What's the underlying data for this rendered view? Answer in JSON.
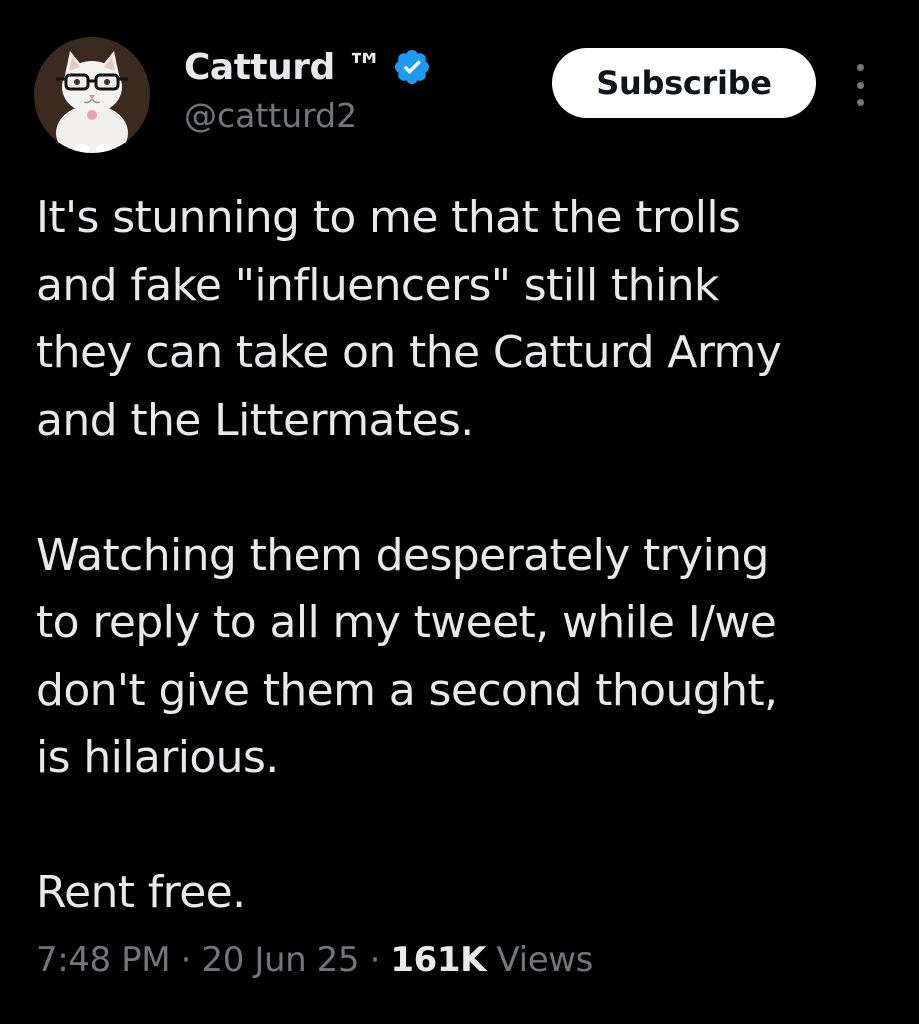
{
  "author": {
    "display_name": "Catturd ™",
    "handle": "@catturd2",
    "verified_icon": "verified-badge-icon",
    "avatar_icon": "cat-with-glasses-avatar",
    "verified_color": "#1d9bf0"
  },
  "actions": {
    "subscribe_label": "Subscribe",
    "more_icon": "vertical-ellipsis-icon"
  },
  "tweet": {
    "paragraphs": [
      {
        "lines": [
          "It's stunning to me that the trolls",
          "and fake \"influencers\" still think",
          "they can take on the Catturd Army",
          "and the Littermates."
        ]
      },
      {
        "lines": [
          "Watching them desperately trying",
          "to reply to all my tweet, while I/we",
          "don't give them a second thought,",
          "is hilarious."
        ]
      },
      {
        "lines": [
          "Rent free."
        ]
      }
    ]
  },
  "meta": {
    "time": "7:48 PM",
    "separator": "·",
    "date": "20 Jun 25",
    "views_count": "161K",
    "views_label": "Views"
  },
  "colors": {
    "background": "#000000",
    "primary_text": "#e7e9ea",
    "secondary_text": "#71767b",
    "button_bg": "#ffffff",
    "button_text": "#0f1419"
  }
}
